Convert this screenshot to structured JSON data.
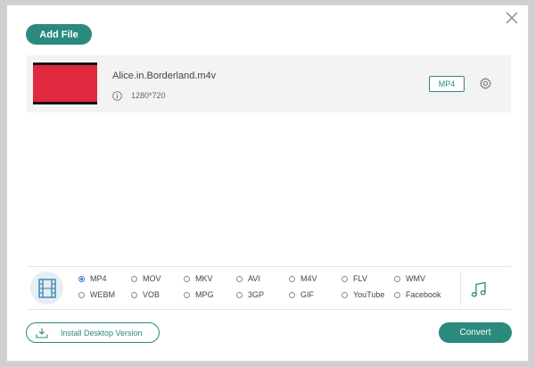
{
  "toolbar": {
    "add_file_label": "Add File"
  },
  "file": {
    "name": "Alice.in.Borderland.m4v",
    "resolution": "1280*720",
    "format": "MP4"
  },
  "formats": {
    "selected": "MP4",
    "row1": [
      "MP4",
      "MOV",
      "MKV",
      "AVI",
      "M4V",
      "FLV",
      "WMV"
    ],
    "row2": [
      "WEBM",
      "VOB",
      "MPG",
      "3GP",
      "GIF",
      "YouTube",
      "Facebook"
    ]
  },
  "footer": {
    "install_label": "Install Desktop Version",
    "convert_label": "Convert"
  },
  "colors": {
    "accent": "#2b8a7e",
    "thumbnail": "#e0293e",
    "radio_selected": "#3a7bd5"
  },
  "icons": [
    "close-icon",
    "info-icon",
    "gear-icon",
    "film-icon",
    "music-note-icon",
    "download-icon"
  ]
}
